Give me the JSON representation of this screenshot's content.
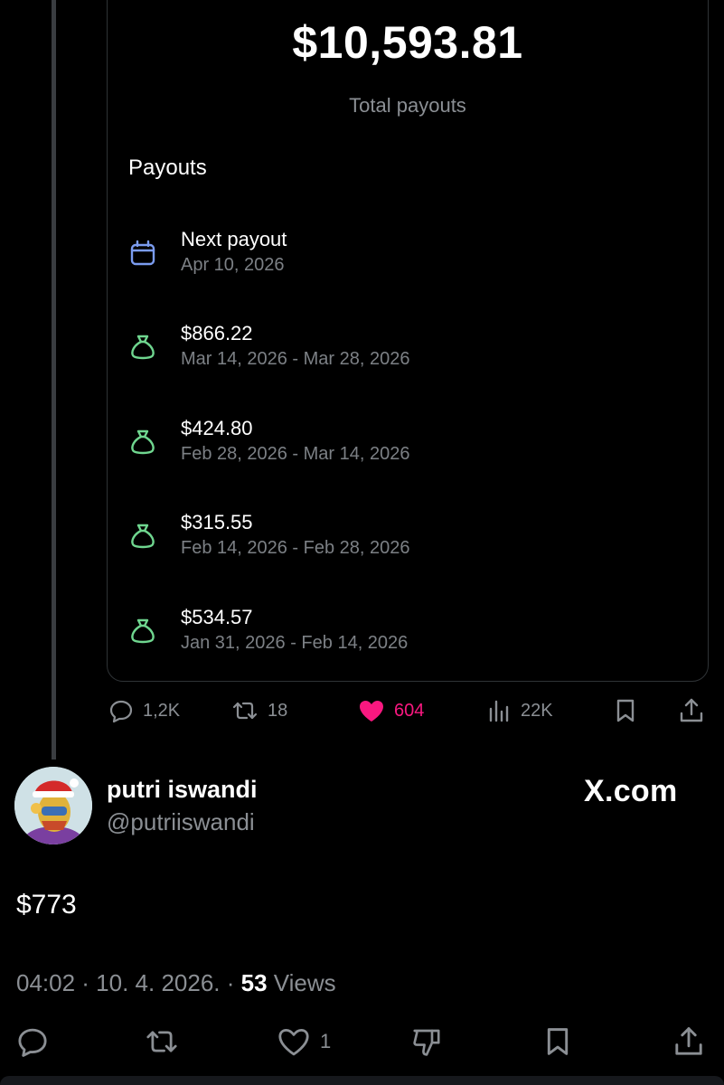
{
  "card": {
    "total_amount": "$10,593.81",
    "total_label": "Total payouts",
    "section_title": "Payouts",
    "next_payout": {
      "title": "Next payout",
      "date": "Apr 10, 2026",
      "icon": "calendar-icon"
    },
    "payouts": [
      {
        "amount": "$866.22",
        "range": "Mar 14, 2026 - Mar 28, 2026",
        "icon": "money-bag-icon"
      },
      {
        "amount": "$424.80",
        "range": "Feb 28, 2026 - Mar 14, 2026",
        "icon": "money-bag-icon"
      },
      {
        "amount": "$315.55",
        "range": "Feb 14, 2026 - Feb 28, 2026",
        "icon": "money-bag-icon"
      },
      {
        "amount": "$534.57",
        "range": "Jan 31, 2026 - Feb 14, 2026",
        "icon": "money-bag-icon"
      }
    ]
  },
  "quoted_actions": {
    "replies": "1,2K",
    "reposts": "18",
    "likes": "604",
    "views": "22K"
  },
  "post": {
    "author_name": "putri iswandi",
    "author_handle": "@putriiswandi",
    "watermark": "X.com",
    "text": "$773",
    "time": "04:02 · 10. 4. 2026. · ",
    "views_count": "53",
    "views_label": " Views"
  },
  "post_actions": {
    "likes": "1"
  },
  "colors": {
    "background": "#000000",
    "like_pink": "#f91880",
    "calendar_blue": "#7b9cf0",
    "money_green": "#6fd68f",
    "muted_text": "#8b8f94"
  }
}
